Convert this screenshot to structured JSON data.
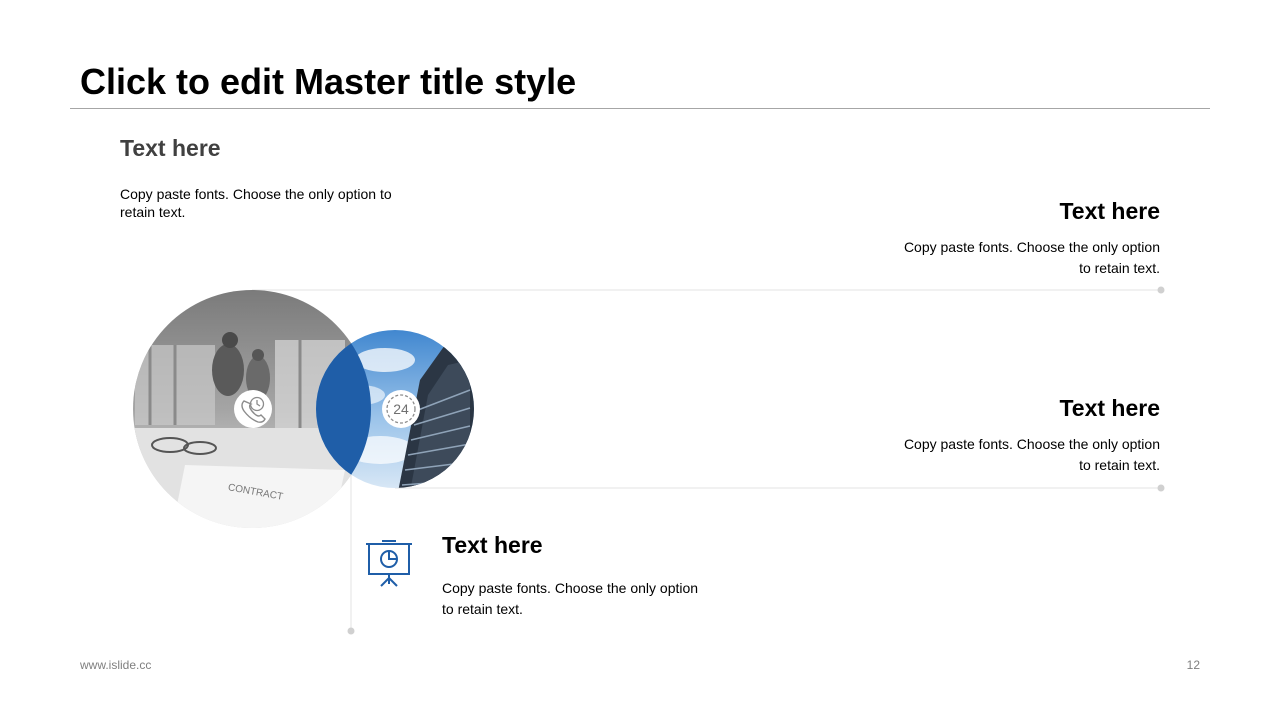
{
  "slide": {
    "title": "Click to edit Master title style"
  },
  "blocks": [
    {
      "heading": "Text here",
      "text": "Copy paste fonts. Choose the only option to retain text."
    },
    {
      "heading": "Text here",
      "text": "Copy paste fonts. Choose the only option to retain text."
    },
    {
      "heading": "Text here",
      "text": "Copy paste fonts. Choose the only option to retain text."
    },
    {
      "heading": "Text here",
      "text": "Copy paste fonts. Choose the only option to retain text."
    }
  ],
  "icons": {
    "photo_left_badge": "phone-clock-icon",
    "photo_right_badge": "24-hours-icon",
    "badge_number": "24",
    "presentation": "presentation-board-icon"
  },
  "colors": {
    "accent_blue": "#1f5ea8",
    "line_gray": "#d9d9d9",
    "dot_gray": "#d0d0d0",
    "footer_gray": "#7f7f7f"
  },
  "footer": {
    "url": "www.islide.cc",
    "page": "12"
  }
}
